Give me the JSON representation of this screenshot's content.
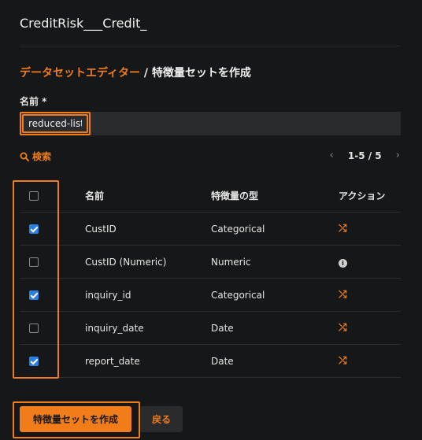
{
  "app": {
    "title": "CreditRisk___Credit_"
  },
  "breadcrumb": {
    "link": "データセットエディター",
    "separator": " / ",
    "current": "特徴量セットを作成"
  },
  "name_field": {
    "label": "名前 *",
    "value": "reduced-list"
  },
  "search": {
    "icon": "search-icon",
    "label": "検索"
  },
  "pager": {
    "range": "1-5 / 5"
  },
  "table": {
    "headers": {
      "name": "名前",
      "type": "特徴量の型",
      "action": "アクション"
    },
    "rows": [
      {
        "checked": true,
        "name": "CustID",
        "type": "Categorical",
        "action_icon": "shuffle-icon"
      },
      {
        "checked": false,
        "name": "CustID (Numeric)",
        "type": "Numeric",
        "action_icon": "info-icon"
      },
      {
        "checked": true,
        "name": "inquiry_id",
        "type": "Categorical",
        "action_icon": "shuffle-icon"
      },
      {
        "checked": false,
        "name": "inquiry_date",
        "type": "Date",
        "action_icon": "shuffle-icon"
      },
      {
        "checked": true,
        "name": "report_date",
        "type": "Date",
        "action_icon": "shuffle-icon"
      }
    ]
  },
  "buttons": {
    "create": "特徴量セットを作成",
    "back": "戻る"
  },
  "colors": {
    "accent": "#f07d1a",
    "checkbox": "#2a7fe0",
    "background": "#161718"
  }
}
